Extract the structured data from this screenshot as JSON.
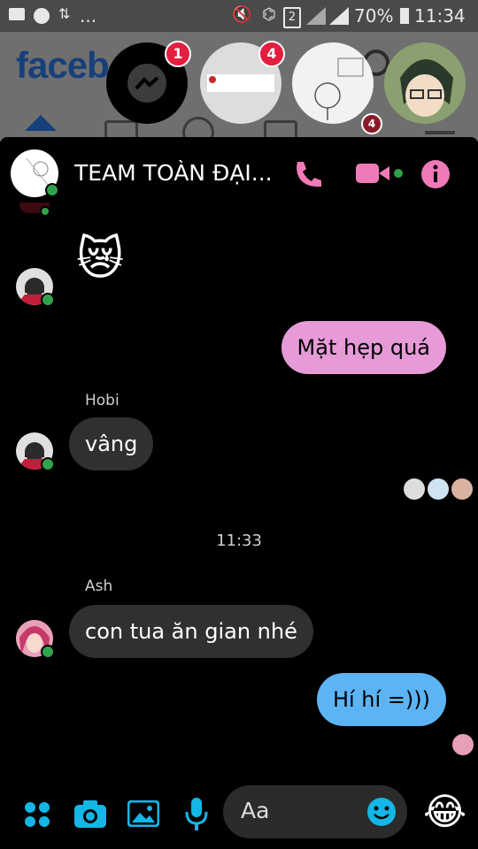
{
  "status_bar": {
    "battery": "70%",
    "time": "11:34",
    "sim": "2",
    "dots": "..."
  },
  "background": {
    "logo": "faceb"
  },
  "chat_heads": [
    {
      "name": "messenger-head",
      "badge": "1"
    },
    {
      "name": "chat-head-2",
      "badge": "4"
    },
    {
      "name": "chat-head-3",
      "badge": ""
    },
    {
      "name": "chat-head-4",
      "badge": ""
    }
  ],
  "nav_badge": "4",
  "header": {
    "title": "TEAM TOÀN ĐẠI...",
    "icons": [
      "phone-icon",
      "video-icon",
      "info-icon"
    ],
    "accent": "#f07ab8"
  },
  "messages": [
    {
      "type": "emoji",
      "text": "😿"
    },
    {
      "type": "outgoing",
      "text": "Mặt hẹp quá",
      "color": "#e79ad8"
    },
    {
      "type": "incoming",
      "sender": "Hobi",
      "text": "vâng"
    },
    {
      "type": "timestamp",
      "text": "11:33"
    },
    {
      "type": "incoming",
      "sender": "Ash",
      "text": "con tua ăn gian nhé"
    },
    {
      "type": "outgoing",
      "text": "Hí hí =)))",
      "color": "#5cb4f5"
    }
  ],
  "composer": {
    "placeholder": "Aa",
    "accent": "#14b6e5",
    "icons": [
      "apps-icon",
      "camera-icon",
      "image-icon",
      "mic-icon",
      "emoji-icon"
    ],
    "quick_reaction": "😂"
  }
}
